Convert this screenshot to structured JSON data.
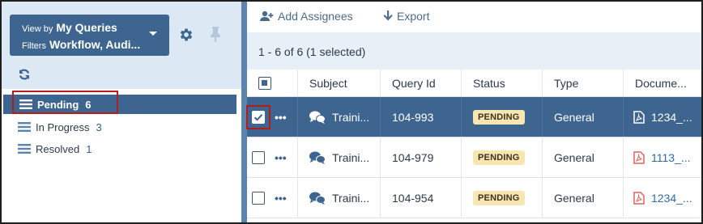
{
  "view_selector": {
    "view_by_label": "View by",
    "view_by_value": "My Queries",
    "filters_label": "Filters",
    "filters_value": "Workflow, Audi..."
  },
  "icons": {
    "settings": "gear-icon",
    "pin": "pin-icon",
    "refresh": "refresh-icon",
    "list": "list-icon",
    "add_assignees": "add-user-icon",
    "export": "download-arrow-icon",
    "chat": "chat-icon",
    "pdf": "pdf-file-icon",
    "more": "more-dots-icon"
  },
  "sidebar": {
    "items": [
      {
        "label": "Pending",
        "count": "6",
        "active": true
      },
      {
        "label": "In Progress",
        "count": "3",
        "active": false
      },
      {
        "label": "Resolved",
        "count": "1",
        "active": false
      }
    ]
  },
  "toolbar": {
    "add_assignees": "Add Assignees",
    "export": "Export"
  },
  "status": {
    "summary": "1 - 6 of 6 (1 selected)"
  },
  "table": {
    "columns": [
      "Subject",
      "Query Id",
      "Status",
      "Type",
      "Docume..."
    ],
    "rows": [
      {
        "subject": "Traini...",
        "query_id": "104-993",
        "status": "PENDING",
        "type": "General",
        "document": "1234_...",
        "selected": true
      },
      {
        "subject": "Traini...",
        "query_id": "104-979",
        "status": "PENDING",
        "type": "General",
        "document": "1113_...",
        "selected": false
      },
      {
        "subject": "Traini...",
        "query_id": "104-954",
        "status": "PENDING",
        "type": "General",
        "document": "1234_...",
        "selected": false
      }
    ]
  },
  "colors": {
    "primary": "#3d6590",
    "sidebar_bg": "#dce8f4",
    "status_badge": "#f7e6b2",
    "highlight_box": "#b01e1e",
    "pdf_icon": "#e0625a"
  }
}
